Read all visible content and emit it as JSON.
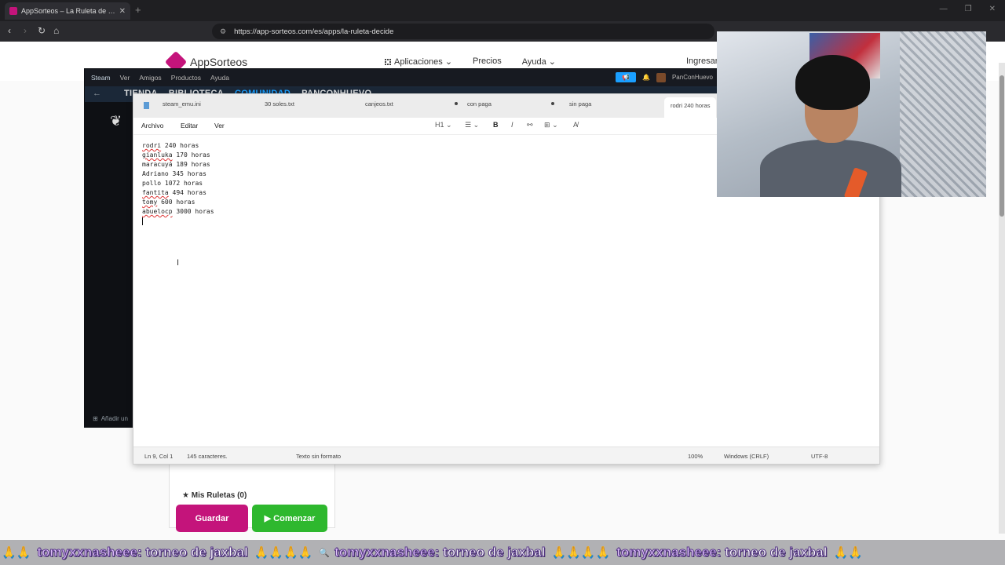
{
  "browser": {
    "tab_title": "AppSorteos – La Ruleta de la Su...",
    "url": "https://app-sorteos.com/es/apps/la-ruleta-decide"
  },
  "site": {
    "brand": "AppSorteos",
    "nav": [
      "Aplicaciones",
      "Precios",
      "Ayuda"
    ],
    "login": "Ingresar",
    "mis_ruletas": "Mis Ruletas (0)",
    "guardar": "Guardar",
    "comenzar": "Comenzar",
    "brand_color": "#c4147b",
    "start_color": "#2eb82e"
  },
  "steam": {
    "menu": [
      "Steam",
      "Ver",
      "Amigos",
      "Productos",
      "Ayuda"
    ],
    "nav_links": [
      "TIENDA",
      "BIBLIOTECA",
      "COMUNIDAD",
      "PANCONHUEVO"
    ],
    "username": "PanConHuevo",
    "add_label": "Añadir un"
  },
  "notepad": {
    "tabs": [
      "steam_emu.ini",
      "30 soles.txt",
      "canjeos.txt",
      "con paga",
      "sin paga",
      "rodri 240 horas"
    ],
    "menu": [
      "Archivo",
      "Editar",
      "Ver"
    ],
    "toolbar": {
      "heading": "H1"
    },
    "lines": [
      {
        "name": "rodri",
        "rest": " 240 horas"
      },
      {
        "name": "gianluka",
        "rest": " 170 horas"
      },
      {
        "name": "maracuyá",
        "rest": " 189 horas"
      },
      {
        "name": "Adriano",
        "rest": " 345 horas"
      },
      {
        "name": "pollo",
        "rest": " 1072 horas"
      },
      {
        "name": "fantita",
        "rest": " 494 horas"
      },
      {
        "name": "tomy",
        "rest": " 600 horas"
      },
      {
        "name": "abuelocp",
        "rest": " 3000 horas"
      }
    ],
    "status": {
      "position": "Ln 9, Col 1",
      "chars": "145 caracteres.",
      "format": "Texto sin formato",
      "zoom": "100%",
      "eol": "Windows (CRLF)",
      "encoding": "UTF-8"
    }
  },
  "ticker": {
    "user": "tomyxxnasheee",
    "message": ": torneo de jaxbal"
  }
}
